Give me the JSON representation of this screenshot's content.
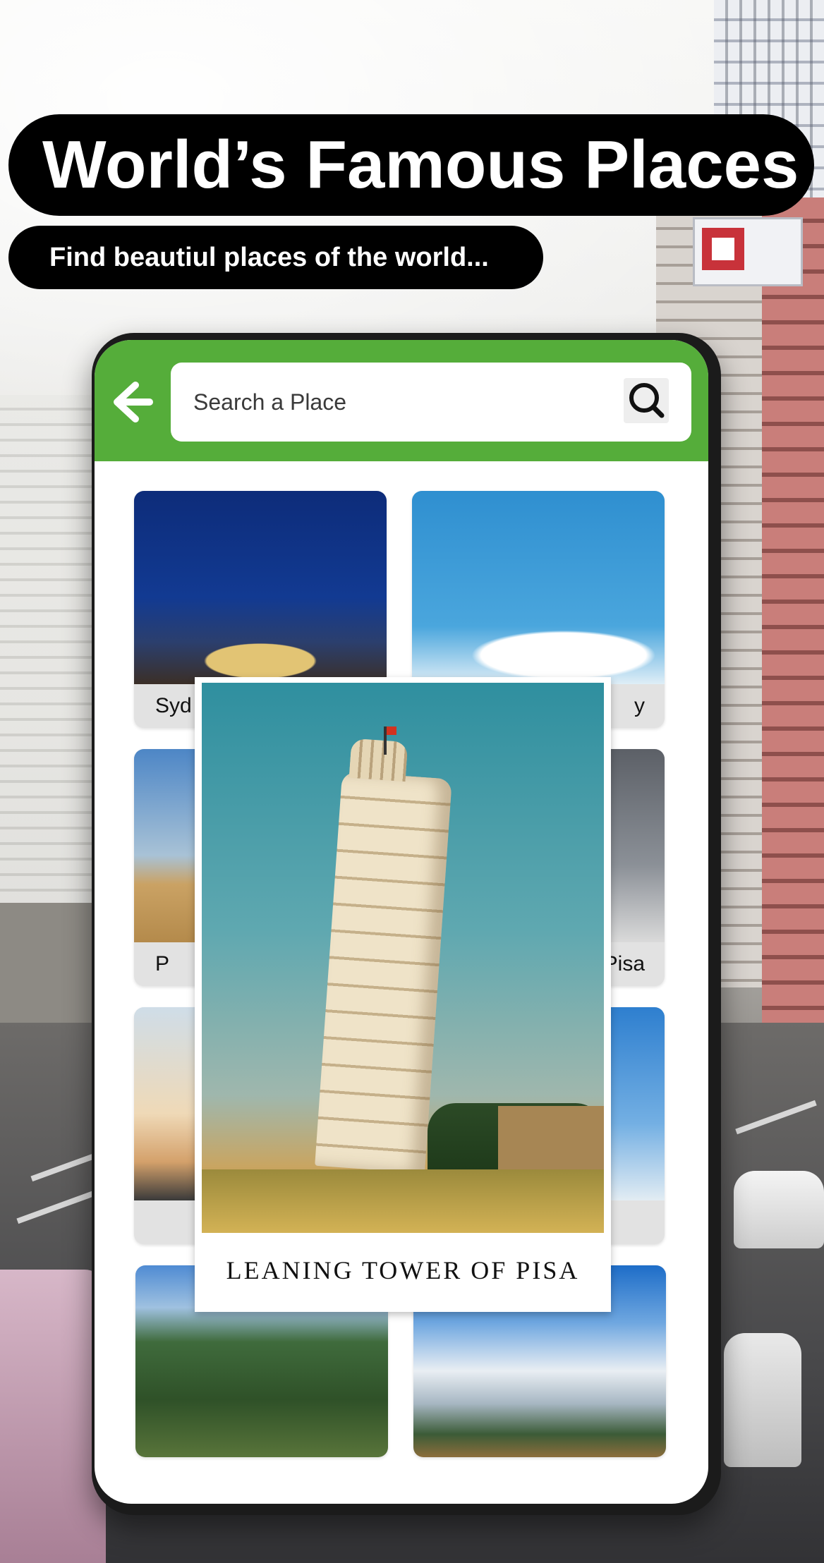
{
  "header": {
    "title": "World’s Famous Places",
    "subtitle": "Find beautiul places of the world..."
  },
  "appbar": {
    "back_icon": "arrow-left-icon",
    "search_placeholder": "Search a Place",
    "search_icon": "search-icon",
    "color": "#55ad3a"
  },
  "grid": {
    "cards": [
      {
        "label": "Syd",
        "photo": "sydney-opera-house"
      },
      {
        "label": "y",
        "photo": "statue-of-liberty"
      },
      {
        "label": "P",
        "photo": "pyramids-of-giza"
      },
      {
        "label": "Pisa",
        "photo": "leaning-tower-of-pisa"
      },
      {
        "label": "",
        "photo": "taj-mahal"
      },
      {
        "label": "",
        "photo": "st-basils-cathedral"
      },
      {
        "label": "",
        "photo": "machu-picchu"
      },
      {
        "label": "",
        "photo": "easter-island-moai"
      }
    ]
  },
  "featured": {
    "caption": "LEANING TOWER OF PISA",
    "photo": "leaning-tower-of-pisa"
  }
}
